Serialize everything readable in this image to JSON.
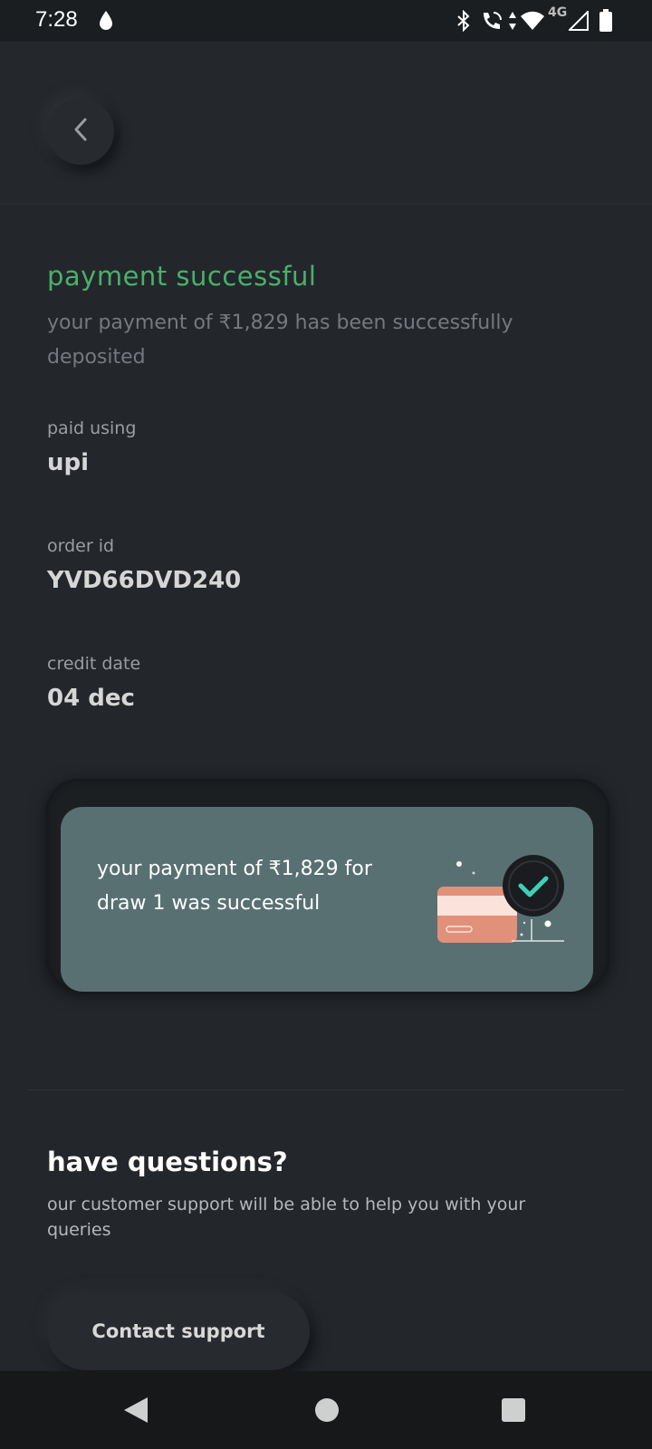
{
  "status_bar": {
    "time": "7:28",
    "icons": [
      "drop-icon",
      "bluetooth-icon",
      "wifi-calling-icon",
      "data-arrows-icon",
      "wifi-icon",
      "4g-icon",
      "signal-icon",
      "battery-icon"
    ],
    "network_label": "4G"
  },
  "header": {
    "back_icon": "chevron-left-icon"
  },
  "payment": {
    "title": "payment successful",
    "description": "your payment of ₹1,829 has been successfully deposited",
    "accent_color": "#4caf6a"
  },
  "details": {
    "paid_using_label": "paid using",
    "paid_using_value": "upi",
    "order_id_label": "order id",
    "order_id_value": "YVD66DVD240",
    "credit_date_label": "credit date",
    "credit_date_value": "04 dec"
  },
  "card": {
    "message": "your payment of ₹1,829 for draw 1 was successful",
    "illustration": "card-check-icon",
    "background_color": "#587072"
  },
  "support": {
    "title": "have questions?",
    "description": "our customer support will be able to help you with your queries",
    "button_label": "Contact support"
  },
  "nav_bar": {
    "buttons": [
      "back-nav-icon",
      "home-nav-icon",
      "recents-nav-icon"
    ]
  }
}
